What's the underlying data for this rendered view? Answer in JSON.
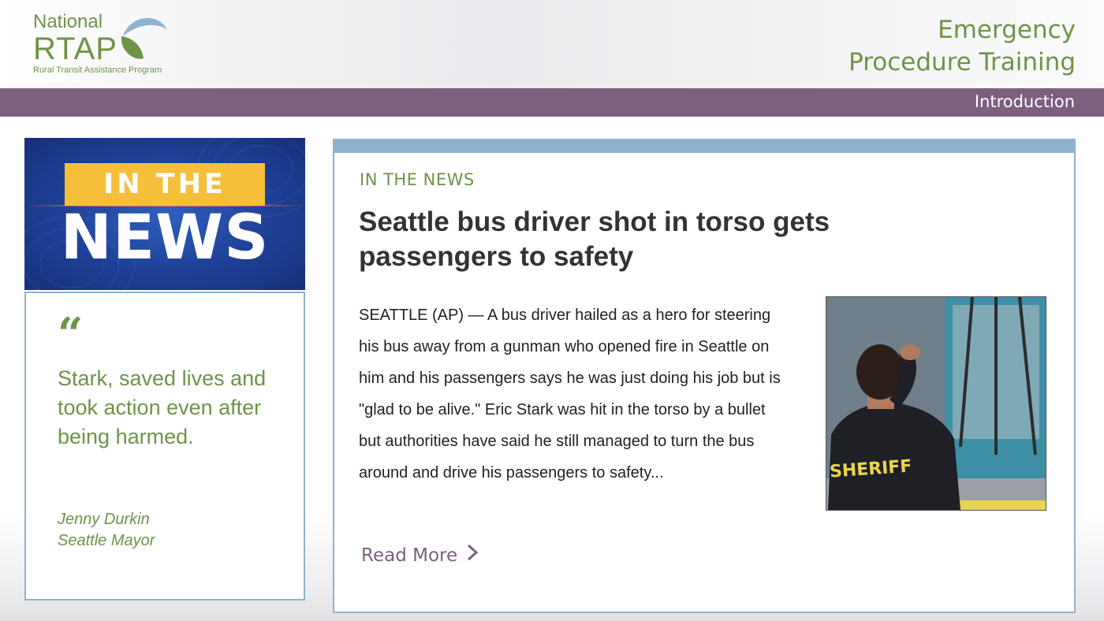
{
  "logo": {
    "line1": "National",
    "line2": "RTAP",
    "subtitle": "Rural Transit Assistance Program"
  },
  "header": {
    "title_line1": "Emergency",
    "title_line2": "Procedure Training",
    "section": "Introduction"
  },
  "banner": {
    "top_text": "IN THE",
    "bottom_text": "NEWS"
  },
  "quote": {
    "mark": "“",
    "text": "Stark, saved lives and took action even after being harmed.",
    "author_name": "Jenny Durkin",
    "author_title": "Seattle Mayor"
  },
  "article": {
    "kicker": "IN THE NEWS",
    "headline": "Seattle bus driver shot in torso gets passengers to safety",
    "body": "SEATTLE (AP) — A bus driver hailed as a hero for steering his bus away from a gunman who opened fire in Seattle on him and his passengers says he was just doing his job but is \"glad to be alive.\" Eric Stark was hit in the torso by a bullet but authorities have said he still managed to turn the bus around and drive his passengers to safety...",
    "photo_label": "SHERIFF",
    "read_more": "Read More",
    "read_more_icon": "chevron-right-icon"
  },
  "colors": {
    "brand_green": "#6e9446",
    "section_bar": "#7c607e",
    "card_border": "#8fb2cf",
    "banner_yellow": "#f6bf3a",
    "banner_blue": "#1e3f95"
  }
}
